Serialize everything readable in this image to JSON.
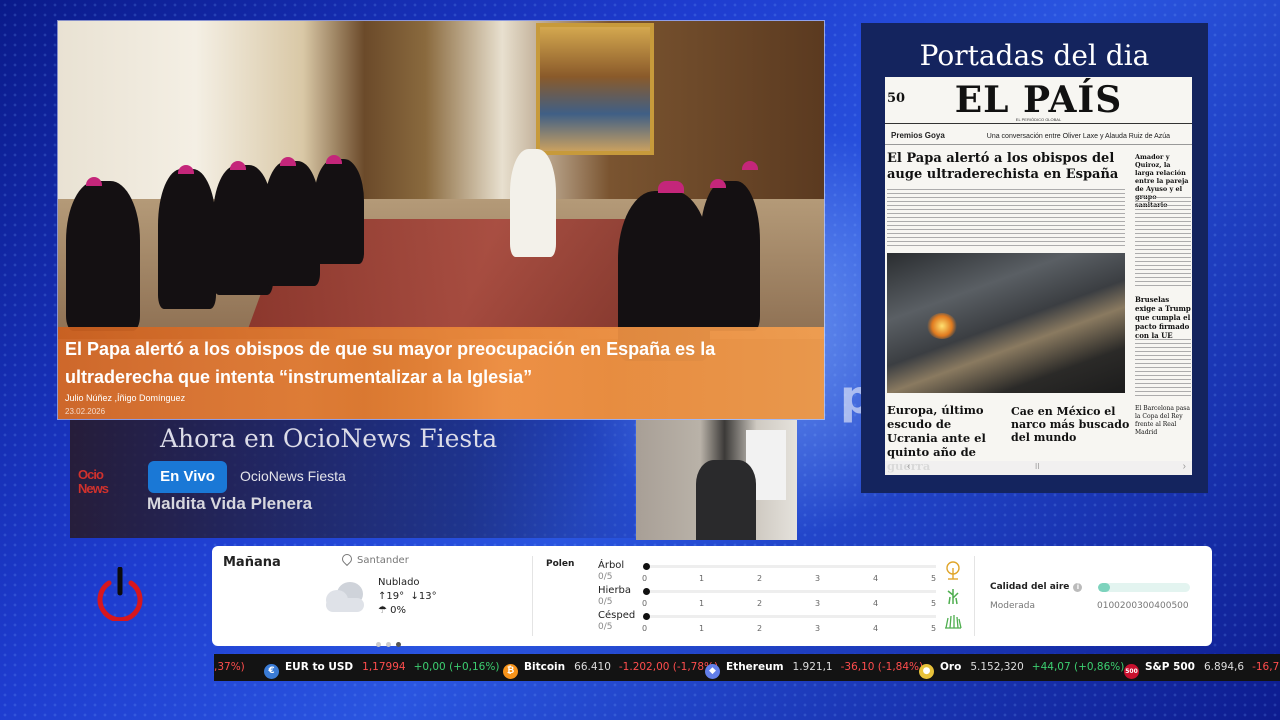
{
  "news": {
    "headline": "El Papa alertó a los obispos de que su mayor preocupación en España es la ultraderecha que intenta “instrumentalizar a la Iglesia”",
    "author": "Julio Núñez ,Íñigo Domínguez",
    "date": "23.02.2026"
  },
  "portadas": {
    "title": "Portadas del dia",
    "paper": {
      "number": "50",
      "name": "EL PAÍS",
      "tagline": "EL PERIÓDICO GLOBAL",
      "strip_label": "Premios Goya",
      "strip_text": "Una conversación entre Oliver Laxe y Alauda Ruiz de Azúa",
      "main_headline": "El Papa alertó a los obispos del auge ultraderechista en España",
      "side_headline": "Amador y Quiroz, la larga relación entre la pareja de Ayuso y el grupo sanitario",
      "side_headline_2": "Bruselas exige a Trump que cumpla el pacto firmado con la UE",
      "bottom_left": "Europa, último escudo de Ucrania ante el quinto año de guerra",
      "bottom_mid": "Cae en México el narco más buscado del mundo",
      "bottom_right": "El Barcelona pasa la Copa del Rey frente al Real Madrid"
    },
    "nav": {
      "prev": "‹",
      "pause": "II",
      "next": "›"
    }
  },
  "live": {
    "heading": "Ahora en OcioNews Fiesta",
    "logo": "Ocio News",
    "badge": "En Vivo",
    "channel": "OcioNews Fiesta",
    "program": "Maldita Vida Plenera"
  },
  "bg_text": "po",
  "weather": {
    "day": "Mañana",
    "location": "Santander",
    "condition": "Nublado",
    "high": "19°",
    "low": "13°",
    "rain": "0%",
    "icons": {
      "cloud": "cloud-icon",
      "pin": "location-pin-icon",
      "umbrella": "umbrella-icon"
    },
    "pollen": {
      "label": "Polen",
      "ticks": [
        "0",
        "1",
        "2",
        "3",
        "4",
        "5"
      ],
      "items": [
        {
          "name": "Árbol",
          "value": "0/5",
          "level": 0,
          "icon": "tree-icon"
        },
        {
          "name": "Hierba",
          "value": "0/5",
          "level": 0,
          "icon": "grass-icon"
        },
        {
          "name": "Césped",
          "value": "0/5",
          "level": 0,
          "icon": "lawn-icon"
        }
      ]
    },
    "air": {
      "label": "Calidad del aire",
      "info": "i",
      "level": "Moderada",
      "scale": "0100200300400500",
      "fill_fraction": 0.13,
      "color": "#7dd3bd"
    }
  },
  "ticker": [
    {
      "partial": ",37%)",
      "neg": true
    },
    {
      "name": "EUR to USD",
      "price": "1,17994",
      "change": "+0,00 (+0,16%)",
      "neg": false,
      "icon_color": "#3a7bd5",
      "icon": "currency-exchange-icon"
    },
    {
      "name": "Bitcoin",
      "price": "66.410",
      "change": "-1.202,00 (-1,78%)",
      "neg": true,
      "icon_color": "#f7931a",
      "icon": "bitcoin-icon"
    },
    {
      "name": "Ethereum",
      "price": "1.921,1",
      "change": "-36,10 (-1,84%)",
      "neg": true,
      "icon_color": "#627eea",
      "icon": "ethereum-icon"
    },
    {
      "name": "Oro",
      "price": "5.152,320",
      "change": "+44,07 (+0,86%)",
      "neg": false,
      "icon_color": "#e8c23a",
      "icon": "gold-icon"
    },
    {
      "name": "S&P 500",
      "price": "6.894,6",
      "change": "-16,7",
      "neg": true,
      "icon_color": "#c8102e",
      "icon": "sp500-icon",
      "badge": "500"
    }
  ]
}
